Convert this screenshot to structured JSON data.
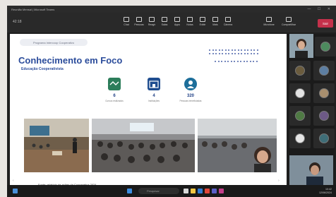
{
  "titlebar": {
    "title": "Reunião Mensal | Microsoft Teams",
    "controls": "— ☐ ✕"
  },
  "toolbar": {
    "timer": "42:18",
    "buttons": [
      {
        "label": "Chat",
        "icon": "chat-icon"
      },
      {
        "label": "Pessoas",
        "icon": "people-icon"
      },
      {
        "label": "Reagir",
        "icon": "reaction-icon"
      },
      {
        "label": "Salas",
        "icon": "rooms-icon"
      },
      {
        "label": "Apps",
        "icon": "apps-icon"
      },
      {
        "label": "Notas",
        "icon": "notes-icon"
      },
      {
        "label": "Exibir",
        "icon": "view-icon"
      },
      {
        "label": "Mais",
        "icon": "more-icon"
      },
      {
        "label": "Câmera",
        "icon": "camera-icon"
      },
      {
        "label": "Microfone",
        "icon": "mic-icon"
      },
      {
        "label": "Compartilhar",
        "icon": "share-icon"
      }
    ],
    "leave_label": "Sair"
  },
  "slide": {
    "pill_text": "Programa Intercoop Cooperativo",
    "title": "Conhecimento em Foco",
    "subtitle": "Educação Cooperativista",
    "stats": [
      {
        "value": "6",
        "label": "Cursos realizados"
      },
      {
        "value": "4",
        "label": "Instituições"
      },
      {
        "value": "320",
        "label": "Pessoas beneficiadas"
      }
    ],
    "caption": "Fonte: relatório de ações da Cooperativa 2024"
  },
  "participants": {
    "count": 11
  },
  "taskbar": {
    "search_placeholder": "Pesquisar",
    "time": "10:42",
    "date": "12/06/2024"
  },
  "colors": {
    "accent": "#2b4c9b",
    "leave": "#c4314b",
    "stage_bg": "#ffffff"
  }
}
